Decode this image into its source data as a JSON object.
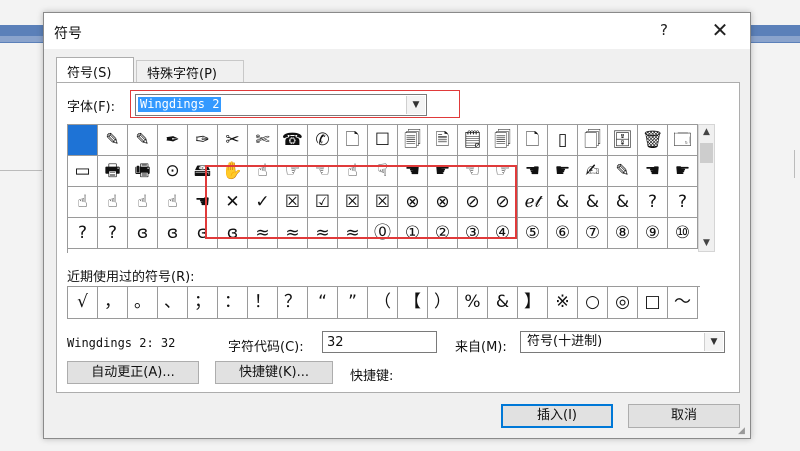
{
  "dialog": {
    "title": "符号",
    "help": "?",
    "close": "✕"
  },
  "tabs": [
    {
      "label": "符号(S)"
    },
    {
      "label": "特殊字符(P)"
    }
  ],
  "font": {
    "label": "字体(F):",
    "value": "Wingdings 2"
  },
  "symbol_rows": [
    [
      "",
      "✎",
      "✎",
      "✒",
      "✑",
      "✂",
      "✄",
      "☎",
      "✆",
      "🗋",
      "☐",
      "🗐",
      "🗎",
      "🗒",
      "🗐",
      "🗋",
      "▯",
      "🗍",
      "🗄",
      "🗑",
      "🗔"
    ],
    [
      "▭",
      "🖶",
      "🖷",
      "⊙",
      "🖴",
      "✋",
      "☝",
      "☞",
      "☜",
      "☝",
      "☟",
      "☚",
      "☛",
      "☜",
      "☞",
      "☚",
      "☛",
      "✍",
      "✎",
      "☚",
      "☛"
    ],
    [
      "☝",
      "☝",
      "☝",
      "☝",
      "☚",
      "✕",
      "✓",
      "☒",
      "☑",
      "☒",
      "☒",
      "⊗",
      "⊗",
      "⊘",
      "⊘",
      "ℯ𝓉",
      "&",
      "&",
      "&",
      "?",
      "?"
    ],
    [
      "?",
      "?",
      "ɞ",
      "ɞ",
      "ɞ",
      "ɞ",
      "≈",
      "≈",
      "≈",
      "≈",
      "⓪",
      "①",
      "②",
      "③",
      "④",
      "⑤",
      "⑥",
      "⑦",
      "⑧",
      "⑨",
      "⑩"
    ]
  ],
  "recent": {
    "label": "近期使用过的符号(R):",
    "symbols": [
      "√",
      "，",
      "。",
      "、",
      "；",
      "：",
      "！",
      "？",
      "“",
      "”",
      "（",
      "【",
      "）",
      "%",
      "&",
      "】",
      "※",
      "○",
      "◎",
      "□",
      "～"
    ]
  },
  "info": {
    "char_name": "Wingdings 2: 32",
    "code_label": "字符代码(C):",
    "code_value": "32",
    "from_label": "来自(M):",
    "from_value": "符号(十进制)"
  },
  "buttons": {
    "autocorrect": "自动更正(A)...",
    "shortcut_key": "快捷键(K)...",
    "shortcut_label": "快捷键:",
    "insert": "插入(I)",
    "cancel": "取消"
  },
  "colors": {
    "selection": "#1e73d6",
    "highlight_box": "#e03a3a",
    "default_button_border": "#0078d7"
  }
}
